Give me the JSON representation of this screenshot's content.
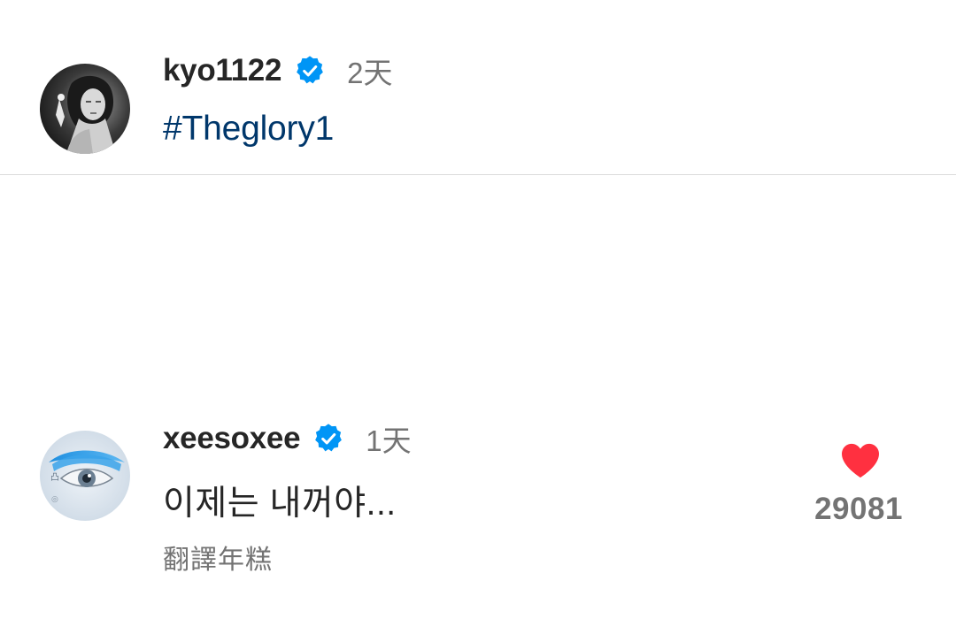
{
  "post": {
    "author": {
      "username": "kyo1122",
      "verified": true,
      "time": "2天",
      "avatar_icon": "profile-photo-bw"
    },
    "caption": "#Theglory1"
  },
  "comment": {
    "username": "xeesoxee",
    "verified": true,
    "time": "1天",
    "avatar_icon": "blue-eye-avatar",
    "text": "이제는 내꺼야...",
    "translate_label": "翻譯年糕",
    "likes": "29081",
    "like_icon": "heart-icon-filled"
  },
  "colors": {
    "text_primary": "#262626",
    "text_secondary": "#737373",
    "hashtag": "#00376b",
    "verified_badge": "#0095f6",
    "like_heart": "#ff3040",
    "divider": "#dbdbdb"
  }
}
